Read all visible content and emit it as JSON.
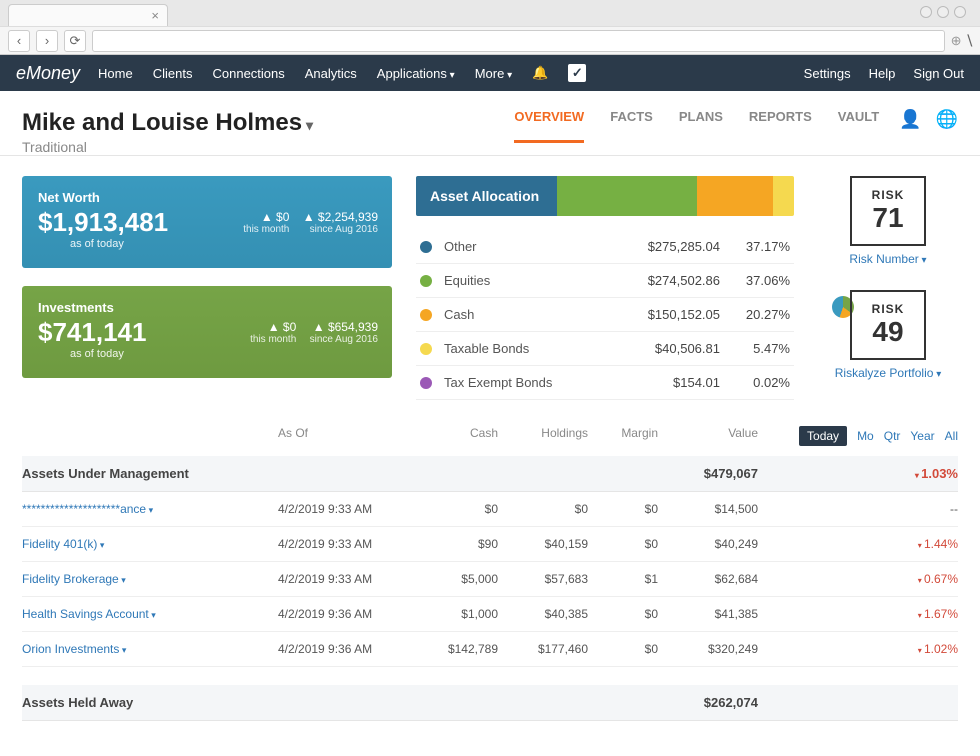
{
  "nav": {
    "logo": "eMoney",
    "items": [
      "Home",
      "Clients",
      "Connections",
      "Analytics",
      "Applications",
      "More"
    ],
    "right": {
      "settings": "Settings",
      "help": "Help",
      "signout": "Sign Out"
    }
  },
  "client": {
    "name": "Mike and Louise Holmes",
    "subtitle": "Traditional"
  },
  "tabs": [
    "OVERVIEW",
    "FACTS",
    "PLANS",
    "REPORTS",
    "VAULT"
  ],
  "cards": {
    "networth": {
      "title": "Net Worth",
      "amount": "$1,913,481",
      "asof": "as of today",
      "d1": "▲ $0",
      "d1_label": "this month",
      "d2": "▲ $2,254,939",
      "d2_label": "since Aug 2016"
    },
    "investments": {
      "title": "Investments",
      "amount": "$741,141",
      "asof": "as of today",
      "d1": "▲ $0",
      "d1_label": "this month",
      "d2": "▲ $654,939",
      "d2_label": "since Aug 2016"
    }
  },
  "alloc": {
    "title": "Asset Allocation",
    "rows": [
      {
        "color": "#2e6e93",
        "name": "Other",
        "val": "$275,285.04",
        "pct": "37.17%"
      },
      {
        "color": "#76b043",
        "name": "Equities",
        "val": "$274,502.86",
        "pct": "37.06%"
      },
      {
        "color": "#f5a623",
        "name": "Cash",
        "val": "$150,152.05",
        "pct": "20.27%"
      },
      {
        "color": "#f5d94f",
        "name": "Taxable Bonds",
        "val": "$40,506.81",
        "pct": "5.47%"
      },
      {
        "color": "#9b59b6",
        "name": "Tax Exempt Bonds",
        "val": "$154.01",
        "pct": "0.02%"
      }
    ]
  },
  "risk": {
    "label": "RISK",
    "n1": "71",
    "link1": "Risk Number",
    "n2": "49",
    "link2": "Riskalyze Portfolio"
  },
  "table": {
    "headers": {
      "asof": "As Of",
      "cash": "Cash",
      "holdings": "Holdings",
      "margin": "Margin",
      "value": "Value"
    },
    "periods": {
      "today": "Today",
      "mo": "Mo",
      "qtr": "Qtr",
      "year": "Year",
      "all": "All"
    },
    "aum": {
      "label": "Assets Under Management",
      "value": "$479,067",
      "change": "1.03%"
    },
    "rows": [
      {
        "name": "*********************ance",
        "asof": "4/2/2019 9:33 AM",
        "cash": "$0",
        "hold": "$0",
        "margin": "$0",
        "value": "$14,500",
        "change": "--",
        "neg": false
      },
      {
        "name": "Fidelity 401(k)",
        "asof": "4/2/2019 9:33 AM",
        "cash": "$90",
        "hold": "$40,159",
        "margin": "$0",
        "value": "$40,249",
        "change": "1.44%",
        "neg": true
      },
      {
        "name": "Fidelity Brokerage",
        "asof": "4/2/2019 9:33 AM",
        "cash": "$5,000",
        "hold": "$57,683",
        "margin": "$1",
        "value": "$62,684",
        "change": "0.67%",
        "neg": true
      },
      {
        "name": "Health Savings Account",
        "asof": "4/2/2019 9:36 AM",
        "cash": "$1,000",
        "hold": "$40,385",
        "margin": "$0",
        "value": "$41,385",
        "change": "1.67%",
        "neg": true
      },
      {
        "name": "Orion Investments",
        "asof": "4/2/2019 9:36 AM",
        "cash": "$142,789",
        "hold": "$177,460",
        "margin": "$0",
        "value": "$320,249",
        "change": "1.02%",
        "neg": true
      }
    ],
    "away": {
      "label": "Assets Held Away",
      "value": "$262,074"
    }
  }
}
